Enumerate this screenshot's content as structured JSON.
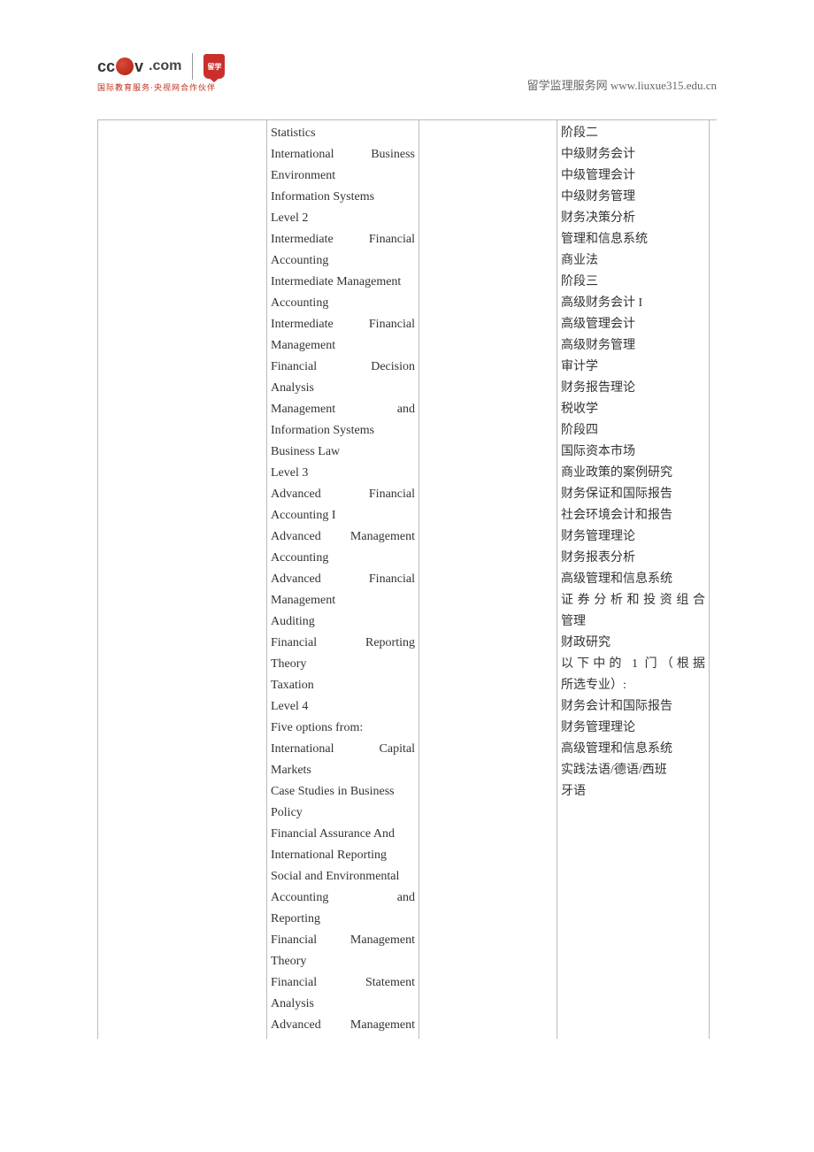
{
  "header": {
    "logo_cctv_left": "cc",
    "logo_cctv_right": "v",
    "logo_com": ".com",
    "logo_shield_text": "留学",
    "logo_tagline": "国际教育服务·央视网合作伙伴",
    "site_label": "留学监理服务网",
    "site_url": "www.liuxue315.edu.cn"
  },
  "col2_lines": [
    {
      "t": "Statistics",
      "j": false
    },
    {
      "t": "International Business",
      "j": true
    },
    {
      "t": "Environment",
      "j": false
    },
    {
      "t": "Information Systems",
      "j": false
    },
    {
      "t": "Level 2",
      "j": false
    },
    {
      "t": "Intermediate Financial",
      "j": true
    },
    {
      "t": "Accounting",
      "j": false
    },
    {
      "t": "Intermediate Management",
      "j": false
    },
    {
      "t": "Accounting",
      "j": false
    },
    {
      "t": "Intermediate Financial",
      "j": true
    },
    {
      "t": "Management",
      "j": false
    },
    {
      "t": "Financial Decision",
      "j": true
    },
    {
      "t": "Analysis",
      "j": false
    },
    {
      "t": "Management and",
      "j": true
    },
    {
      "t": "Information Systems",
      "j": false
    },
    {
      "t": "Business Law",
      "j": false
    },
    {
      "t": "Level 3",
      "j": false
    },
    {
      "t": "Advanced Financial",
      "j": true
    },
    {
      "t": "Accounting I",
      "j": false
    },
    {
      "t": "Advanced Management",
      "j": true
    },
    {
      "t": "Accounting",
      "j": false
    },
    {
      "t": "Advanced Financial",
      "j": true
    },
    {
      "t": "Management",
      "j": false
    },
    {
      "t": "Auditing",
      "j": false
    },
    {
      "t": "Financial Reporting",
      "j": true
    },
    {
      "t": "Theory",
      "j": false
    },
    {
      "t": "Taxation",
      "j": false
    },
    {
      "t": "Level 4",
      "j": false
    },
    {
      "t": "Five options from:",
      "j": false
    },
    {
      "t": "International Capital",
      "j": true
    },
    {
      "t": "Markets",
      "j": false
    },
    {
      "t": "Case Studies in Business",
      "j": false
    },
    {
      "t": "Policy",
      "j": false
    },
    {
      "t": "Financial Assurance And",
      "j": false
    },
    {
      "t": "International Reporting",
      "j": false
    },
    {
      "t": "Social and Environmental",
      "j": false
    },
    {
      "t": "Accounting and",
      "j": true
    },
    {
      "t": "Reporting",
      "j": false
    },
    {
      "t": "Financial Management",
      "j": true
    },
    {
      "t": "Theory",
      "j": false
    },
    {
      "t": "Financial Statement",
      "j": true
    },
    {
      "t": "Analysis",
      "j": false
    },
    {
      "t": "Advanced Management",
      "j": true
    }
  ],
  "col4_lines": [
    {
      "t": "阶段二",
      "j": false
    },
    {
      "t": "中级财务会计",
      "j": false
    },
    {
      "t": "中级管理会计",
      "j": false
    },
    {
      "t": "中级财务管理",
      "j": false
    },
    {
      "t": "财务决策分析",
      "j": false
    },
    {
      "t": "管理和信息系统",
      "j": false
    },
    {
      "t": "商业法",
      "j": false
    },
    {
      "t": "阶段三",
      "j": false
    },
    {
      "t": "高级财务会计 I",
      "j": false
    },
    {
      "t": "高级管理会计",
      "j": false
    },
    {
      "t": "高级财务管理",
      "j": false
    },
    {
      "t": "审计学",
      "j": false
    },
    {
      "t": "财务报告理论",
      "j": false
    },
    {
      "t": "税收学",
      "j": false
    },
    {
      "t": "阶段四",
      "j": false
    },
    {
      "t": "国际资本市场",
      "j": false
    },
    {
      "t": "商业政策的案例研究",
      "j": false
    },
    {
      "t": "财务保证和国际报告",
      "j": false
    },
    {
      "t": "社会环境会计和报告",
      "j": false
    },
    {
      "t": "财务管理理论",
      "j": false
    },
    {
      "t": "财务报表分析",
      "j": false
    },
    {
      "t": "高级管理和信息系统",
      "j": false
    },
    {
      "t": "证券分析和投资组合",
      "j": true
    },
    {
      "t": "管理",
      "j": false
    },
    {
      "t": "财政研究",
      "j": false
    },
    {
      "t": "以下中的 1 门（根据",
      "j": true
    },
    {
      "t": "所选专业）:",
      "j": false
    },
    {
      "t": "财务会计和国际报告",
      "j": false
    },
    {
      "t": "财务管理理论",
      "j": false
    },
    {
      "t": "高级管理和信息系统",
      "j": false
    },
    {
      "t": "实践法语/德语/西班",
      "j": false
    },
    {
      "t": "牙语",
      "j": false
    }
  ]
}
